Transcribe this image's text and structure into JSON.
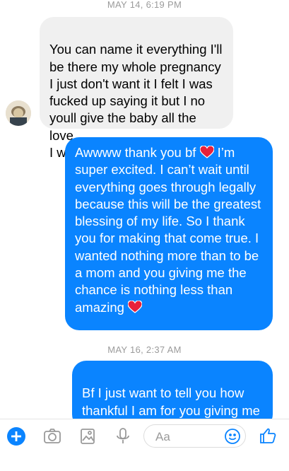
{
  "timestamps": [
    "MAY 14, 6:19 PM",
    "MAY 16, 2:37 AM"
  ],
  "messages": {
    "m1": "You can name it everything I'll\nbe there my whole pregnancy\nI just don't want it I felt I was\nfucked up saying it but I no\nyoull give the baby all the love\nI would",
    "m2a": "Awwww thank you bf",
    "m2b": " I’m\nsuper excited. I can’t wait until\neverything goes through legally\nbecause this will be the greatest\nblessing of my life. So I thank\nyou for making that come true. I\nwanted nothing more than to be\na mom and you giving me the\nchance is nothing less than\namazing",
    "m3": "Bf I just want to tell you how\nthankful I am for you giving me a\nchance to be a mom. I’ve literally"
  },
  "composer": {
    "placeholder": "Aa"
  },
  "colors": {
    "accent": "#0a84ff",
    "received_bubble": "#f0f0f0",
    "heart": "#e8213a"
  },
  "icons": [
    "add-icon",
    "camera-icon",
    "photo-icon",
    "microphone-icon",
    "emoji-icon",
    "thumbs-up-icon",
    "heart-icon"
  ]
}
